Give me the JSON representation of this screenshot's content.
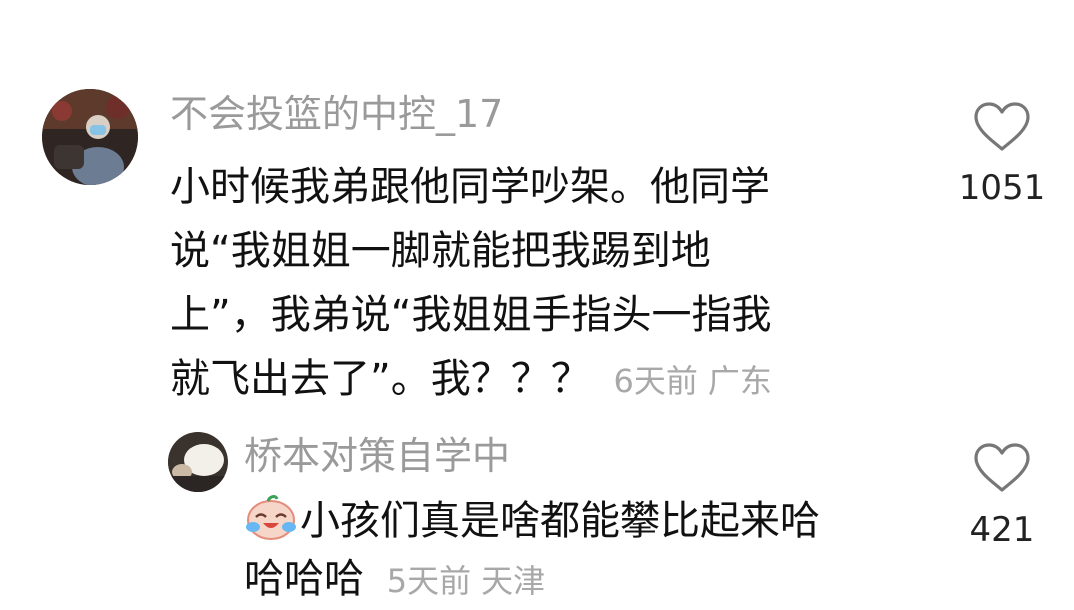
{
  "comments": [
    {
      "username": "不会投篮的中控_17",
      "lines": [
        "小时候我弟跟他同学吵架。他同学",
        "说“我姐姐一脚就能把我踢到地",
        "上”，我弟说“我姐姐手指头一指我",
        "就飞出去了”。我？？？"
      ],
      "time": "6天前",
      "location": "广东",
      "likes": "1051"
    },
    {
      "username": "桥本对策自学中",
      "lines": [
        "小孩们真是啥都能攀比起来哈",
        "哈哈哈"
      ],
      "time": "5天前",
      "location": "天津",
      "likes": "421"
    }
  ],
  "icons": {
    "like": "heart-outline-icon",
    "emoji": "laughing-crying-emoji"
  },
  "colors": {
    "username": "#9a9a9a",
    "text": "#111111",
    "meta": "#a8a8a8",
    "heart": "#777777"
  }
}
